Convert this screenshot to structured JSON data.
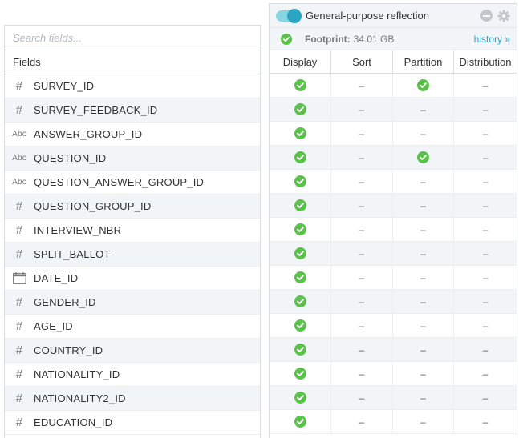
{
  "search": {
    "placeholder": "Search fields..."
  },
  "fields_header": "Fields",
  "reflection": {
    "title": "General-purpose reflection",
    "enabled": true,
    "footprint_label": "Footprint:",
    "footprint_value": "34.01 GB",
    "history_link": "history »",
    "columns": [
      "Display",
      "Sort",
      "Partition",
      "Distribution"
    ]
  },
  "colors": {
    "accent": "#2aa5c2",
    "check_green": "#5ac24a",
    "row_alt": "#f1f5f8"
  },
  "icons": {
    "number": "#",
    "text": "Abc",
    "date": "calendar-icon"
  },
  "fields": [
    {
      "name": "SURVEY_ID",
      "type": "number",
      "display": true,
      "sort": false,
      "partition": true,
      "distribution": false
    },
    {
      "name": "SURVEY_FEEDBACK_ID",
      "type": "number",
      "display": true,
      "sort": false,
      "partition": false,
      "distribution": false
    },
    {
      "name": "ANSWER_GROUP_ID",
      "type": "text",
      "display": true,
      "sort": false,
      "partition": false,
      "distribution": false
    },
    {
      "name": "QUESTION_ID",
      "type": "text",
      "display": true,
      "sort": false,
      "partition": true,
      "distribution": false
    },
    {
      "name": "QUESTION_ANSWER_GROUP_ID",
      "type": "text",
      "display": true,
      "sort": false,
      "partition": false,
      "distribution": false
    },
    {
      "name": "QUESTION_GROUP_ID",
      "type": "number",
      "display": true,
      "sort": false,
      "partition": false,
      "distribution": false
    },
    {
      "name": "INTERVIEW_NBR",
      "type": "number",
      "display": true,
      "sort": false,
      "partition": false,
      "distribution": false
    },
    {
      "name": "SPLIT_BALLOT",
      "type": "number",
      "display": true,
      "sort": false,
      "partition": false,
      "distribution": false
    },
    {
      "name": "DATE_ID",
      "type": "date",
      "display": true,
      "sort": false,
      "partition": false,
      "distribution": false
    },
    {
      "name": "GENDER_ID",
      "type": "number",
      "display": true,
      "sort": false,
      "partition": false,
      "distribution": false
    },
    {
      "name": "AGE_ID",
      "type": "number",
      "display": true,
      "sort": false,
      "partition": false,
      "distribution": false
    },
    {
      "name": "COUNTRY_ID",
      "type": "number",
      "display": true,
      "sort": false,
      "partition": false,
      "distribution": false
    },
    {
      "name": "NATIONALITY_ID",
      "type": "number",
      "display": true,
      "sort": false,
      "partition": false,
      "distribution": false
    },
    {
      "name": "NATIONALITY2_ID",
      "type": "number",
      "display": true,
      "sort": false,
      "partition": false,
      "distribution": false
    },
    {
      "name": "EDUCATION_ID",
      "type": "number",
      "display": true,
      "sort": false,
      "partition": false,
      "distribution": false
    }
  ],
  "dash": "–"
}
